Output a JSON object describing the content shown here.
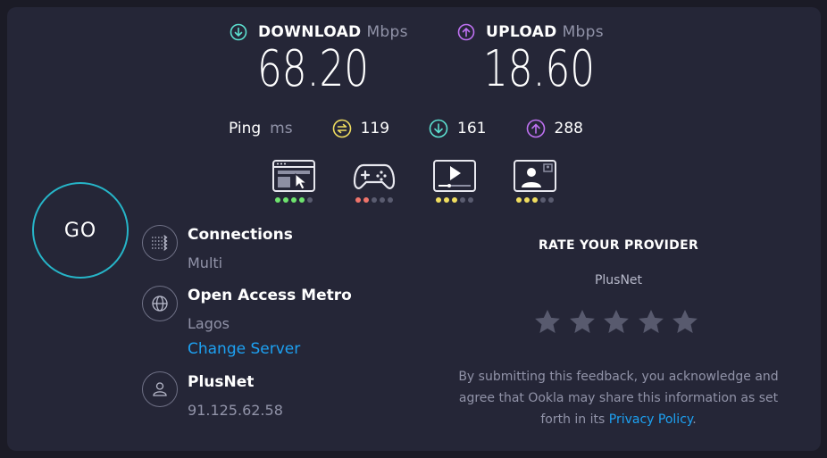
{
  "download": {
    "label": "DOWNLOAD",
    "unit": "Mbps",
    "value": "68.20",
    "color": "#5ce0d0"
  },
  "upload": {
    "label": "UPLOAD",
    "unit": "Mbps",
    "value": "18.60",
    "color": "#bf71f2"
  },
  "ping": {
    "label": "Ping",
    "unit": "ms",
    "idle": "119",
    "download": "161",
    "upload": "288",
    "idle_color": "#f0dd5f"
  },
  "apps": [
    {
      "icon": "browsing-icon",
      "rating": 4,
      "color": "#6ee36e"
    },
    {
      "icon": "gaming-icon",
      "rating": 2,
      "color": "#f0746b"
    },
    {
      "icon": "video-streaming-icon",
      "rating": 3,
      "color": "#f0dd5f"
    },
    {
      "icon": "video-chat-icon",
      "rating": 3,
      "color": "#f0dd5f"
    }
  ],
  "go_label": "GO",
  "connections": {
    "title": "Connections",
    "value": "Multi"
  },
  "server": {
    "title": "Open Access Metro",
    "location": "Lagos",
    "change_label": "Change Server"
  },
  "isp": {
    "title": "PlusNet",
    "ip": "91.125.62.58"
  },
  "rate": {
    "title": "RATE YOUR PROVIDER",
    "provider": "PlusNet",
    "star_count": 5,
    "disclaimer_text": "By submitting this feedback, you acknowledge and agree that Ookla may share this information as set forth in its",
    "privacy_link": "Privacy Policy",
    "disclaimer_end": "."
  },
  "colors": {
    "accent": "#1da1f2",
    "go_ring": "#26b5c8",
    "muted": "#9193a8",
    "panel": "#252637"
  }
}
